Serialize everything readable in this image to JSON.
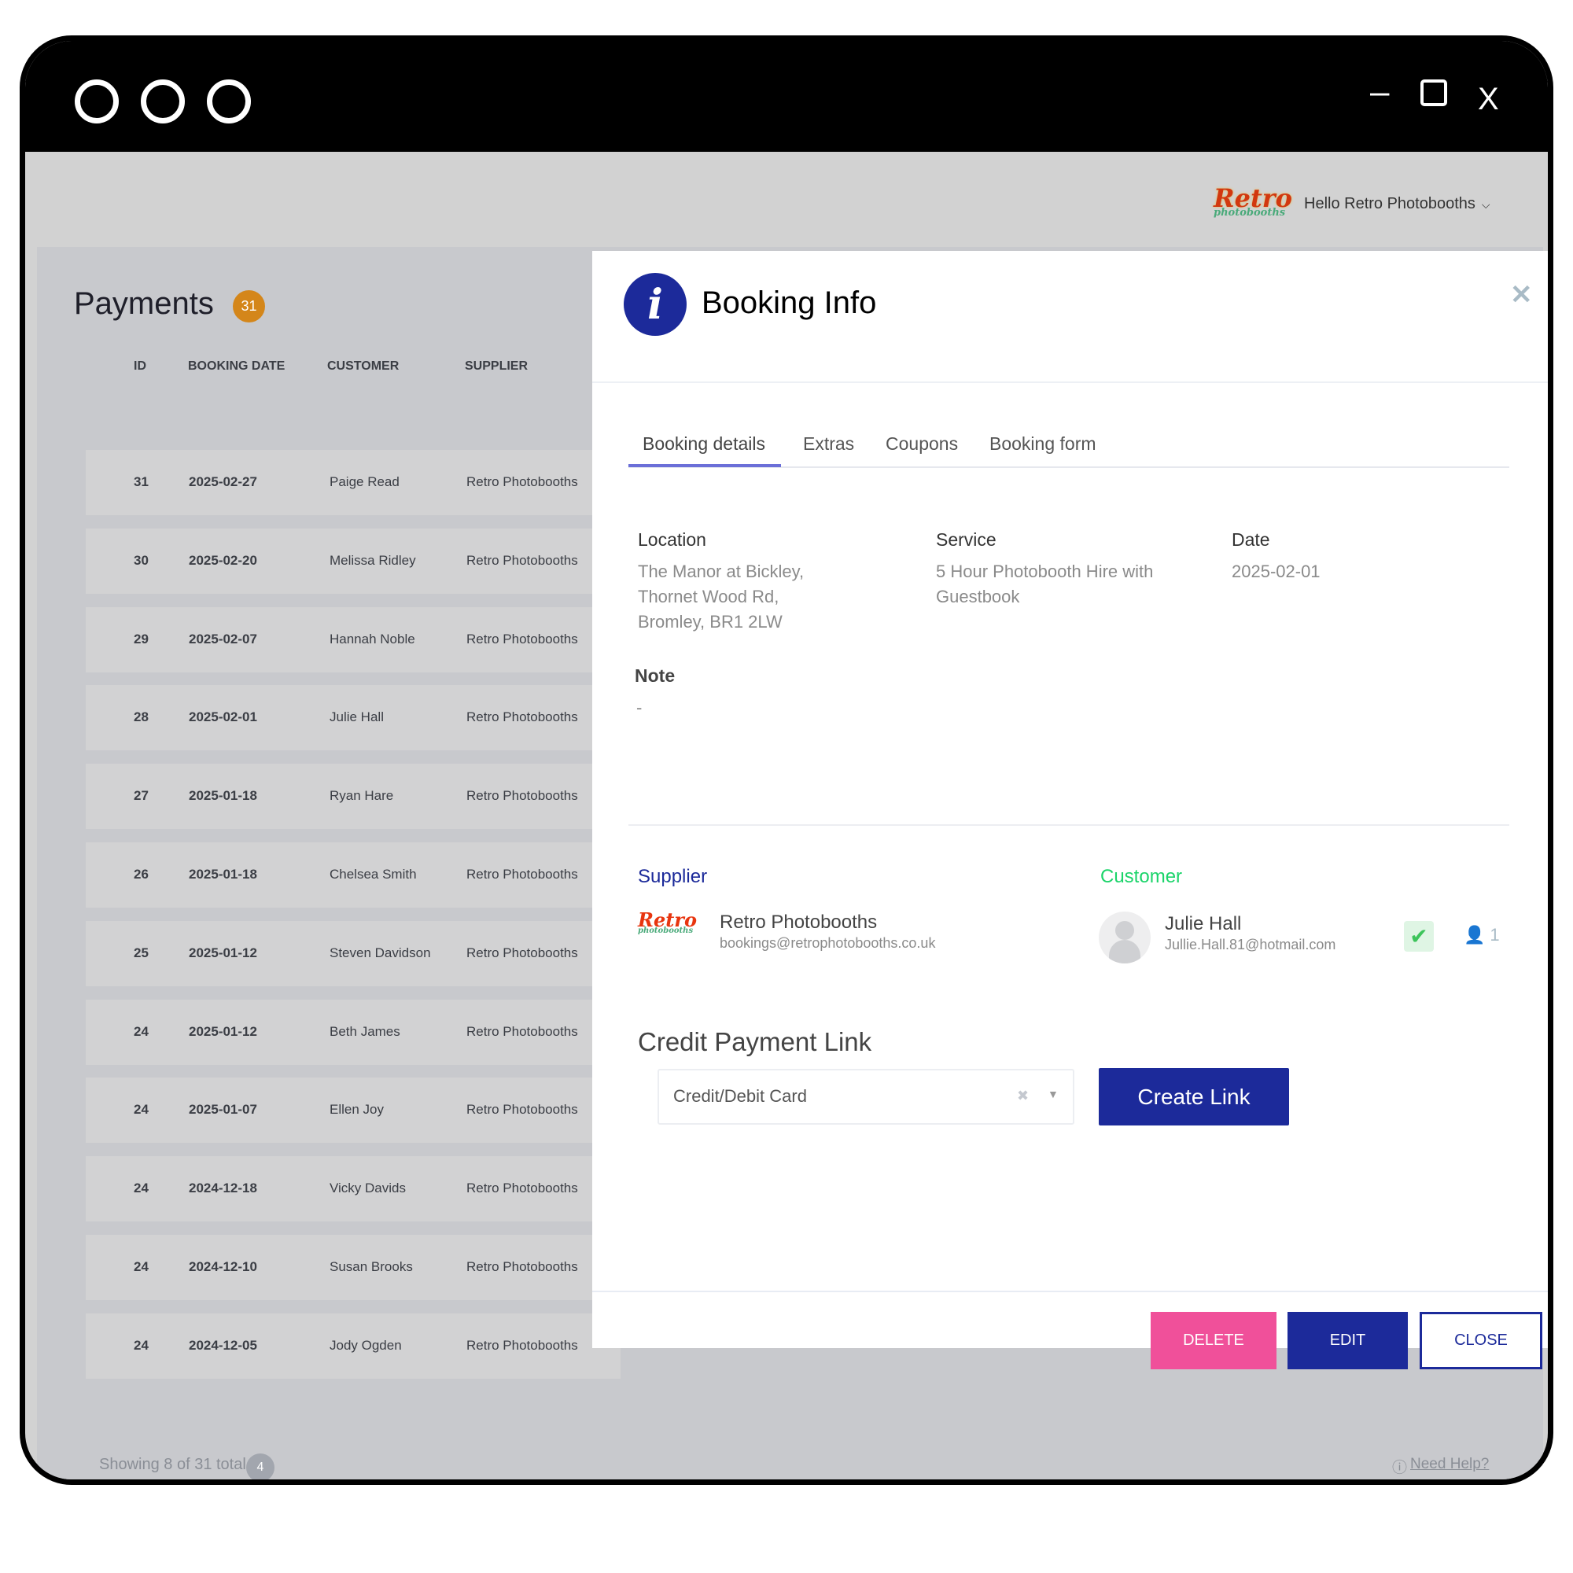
{
  "window": {
    "controls": {
      "minimize": "–",
      "restore": "❐",
      "close": "X"
    }
  },
  "header": {
    "logo_text": "Retro",
    "logo_subtext": "photobooths",
    "greeting": "Hello Retro Photobooths"
  },
  "payments": {
    "title": "Payments",
    "count": "31",
    "columns": [
      "ID",
      "BOOKING DATE",
      "CUSTOMER",
      "SUPPLIER"
    ],
    "rows": [
      [
        "31",
        "2025-02-27",
        "Paige Read",
        "Retro Photobooths"
      ],
      [
        "30",
        "2025-02-20",
        "Melissa Ridley",
        "Retro Photobooths"
      ],
      [
        "29",
        "2025-02-07",
        "Hannah Noble",
        "Retro Photobooths"
      ],
      [
        "28",
        "2025-02-01",
        "Julie Hall",
        "Retro Photobooths"
      ],
      [
        "27",
        "2025-01-18",
        "Ryan Hare",
        "Retro Photobooths"
      ],
      [
        "26",
        "2025-01-18",
        "Chelsea Smith",
        "Retro Photobooths"
      ],
      [
        "25",
        "2025-01-12",
        "Steven Davidson",
        "Retro Photobooths"
      ],
      [
        "24",
        "2025-01-12",
        "Beth James",
        "Retro Photobooths"
      ],
      [
        "24",
        "2025-01-07",
        "Ellen Joy",
        "Retro Photobooths"
      ],
      [
        "24",
        "2024-12-18",
        "Vicky Davids",
        "Retro Photobooths"
      ],
      [
        "24",
        "2024-12-10",
        "Susan Brooks",
        "Retro Photobooths"
      ],
      [
        "24",
        "2024-12-05",
        "Jody Ogden",
        "Retro Photobooths"
      ]
    ],
    "footer": {
      "showing": "Showing 8 of 31 total",
      "page_badge": "4",
      "help": "Need Help?"
    }
  },
  "modal": {
    "title": "Booking Info",
    "tabs": [
      "Booking details",
      "Extras",
      "Coupons",
      "Booking form"
    ],
    "active_tab": "Booking details",
    "location": {
      "label": "Location",
      "lines": [
        "The Manor at Bickley,",
        "Thornet Wood Rd,",
        "Bromley, BR1 2LW"
      ]
    },
    "service": {
      "label": "Service",
      "lines": [
        "5 Hour Photobooth Hire with",
        "Guestbook"
      ]
    },
    "date": {
      "label": "Date",
      "value": "2025-02-01"
    },
    "note": {
      "label": "Note",
      "value": "-"
    },
    "supplier": {
      "label": "Supplier",
      "name": "Retro Photobooths",
      "email": "bookings@retrophotobooths.co.uk"
    },
    "customer": {
      "label": "Customer",
      "name": "Julie Hall",
      "email": "Jullie.Hall.81@hotmail.com",
      "guests": "1"
    },
    "credit": {
      "title": "Credit Payment Link",
      "method": "Credit/Debit Card",
      "create_label": "Create Link"
    },
    "buttons": {
      "delete": "DELETE",
      "edit": "EDIT",
      "close": "CLOSE"
    }
  },
  "colors": {
    "primary": "#1c2a9a",
    "delete": "#f0509a",
    "badge": "#d4861a",
    "customer": "#1bd46a",
    "tab_underline": "#6b6fd8"
  }
}
